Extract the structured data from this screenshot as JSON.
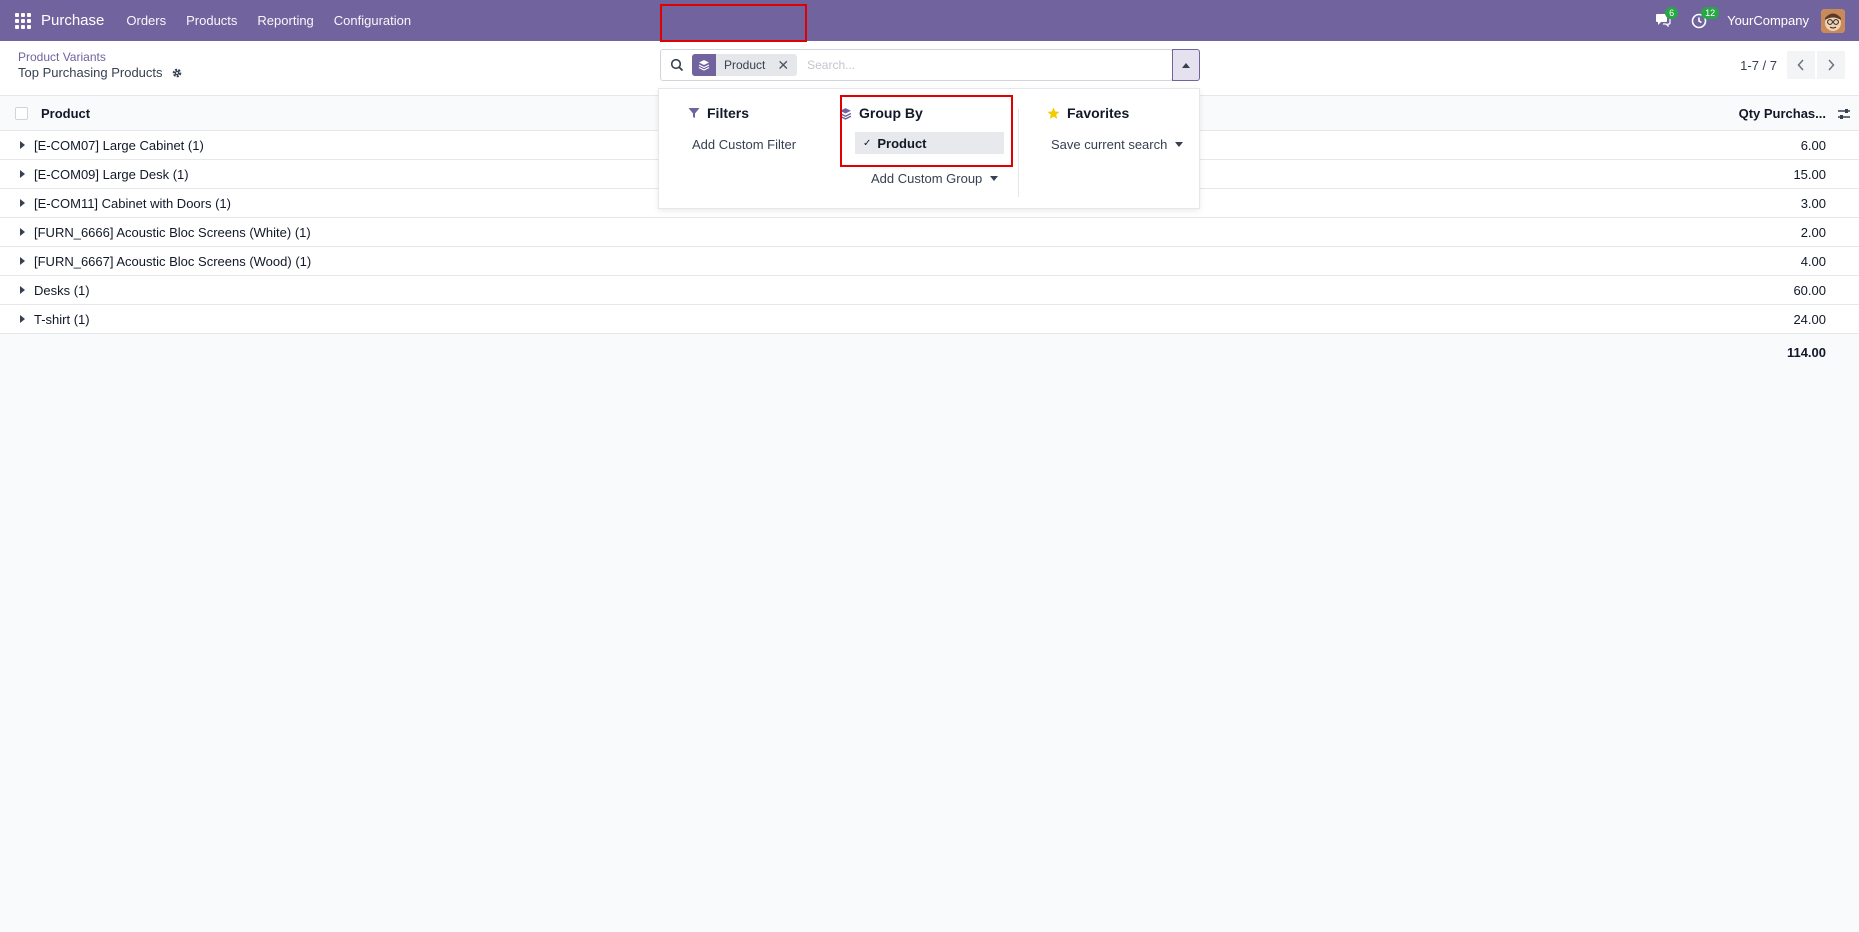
{
  "navbar": {
    "brand": "Purchase",
    "menu": [
      "Orders",
      "Products",
      "Reporting",
      "Configuration"
    ],
    "messages_count": "6",
    "activities_count": "12",
    "company": "YourCompany"
  },
  "breadcrumb": {
    "parent": "Product Variants",
    "current": "Top Purchasing Products"
  },
  "search": {
    "facet_label": "Product",
    "placeholder": "Search..."
  },
  "pager": {
    "value": "1-7 / 7"
  },
  "dropdown": {
    "filters_title": "Filters",
    "add_custom_filter": "Add Custom Filter",
    "groupby_title": "Group By",
    "groupby_selected": "Product",
    "add_custom_group": "Add Custom Group",
    "favorites_title": "Favorites",
    "save_current_search": "Save current search"
  },
  "list": {
    "col_product": "Product",
    "col_qty": "Qty Purchas...",
    "groups": [
      {
        "name": "[E-COM07] Large Cabinet (1)",
        "qty": "6.00"
      },
      {
        "name": "[E-COM09] Large Desk (1)",
        "qty": "15.00"
      },
      {
        "name": "[E-COM11] Cabinet with Doors (1)",
        "qty": "3.00"
      },
      {
        "name": "[FURN_6666] Acoustic Bloc Screens (White) (1)",
        "qty": "2.00"
      },
      {
        "name": "[FURN_6667] Acoustic Bloc Screens (Wood) (1)",
        "qty": "4.00"
      },
      {
        "name": "Desks (1)",
        "qty": "60.00"
      },
      {
        "name": "T-shirt (1)",
        "qty": "24.00"
      }
    ],
    "total": "114.00"
  },
  "colors": {
    "brand": "#71639e",
    "highlight": "#e00000",
    "badge": "#28a745"
  }
}
